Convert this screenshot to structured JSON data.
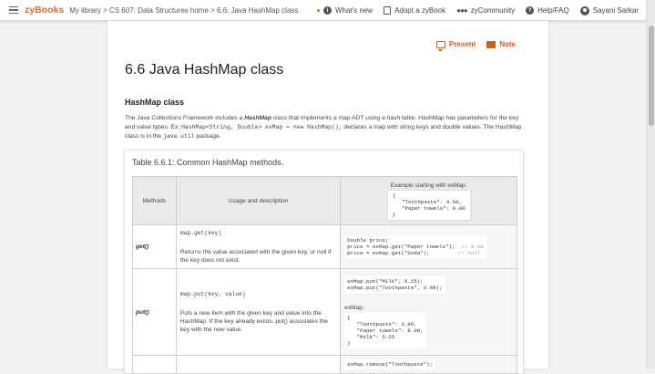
{
  "topbar": {
    "logo": "zyBooks",
    "breadcrumb": "My library > CS 607: Data Structures home > 6.6: Java HashMap class",
    "whats_new": "What's new",
    "adopt": "Adopt a zyBook",
    "community": "zyCommunity",
    "help": "Help/FAQ",
    "user": "Sayani Sarkar"
  },
  "tools": {
    "present": "Present",
    "note": "Note"
  },
  "section": {
    "title": "6.6 Java HashMap class",
    "heading": "HashMap class",
    "para_1": "The Java Collections Framework includes a ",
    "para_bold": "HashMap",
    "para_2": " class that implements a map ADT using a hash table. HashMap has parameters for the key and value types. Ex: ",
    "para_code_1": "HashMap<String, Double> exMap = new HashMap();",
    "para_3": " declares a map with string keys and double values. The HashMap class is in the ",
    "para_code_2": "java.util",
    "para_4": " package."
  },
  "table": {
    "caption": "Table 6.6.1: Common HashMap methods.",
    "headers": {
      "methods": "Methods",
      "usage": "Usage and description",
      "example": "Example starting with exMap:"
    },
    "example_map": "{\n   \"Toothpaste\": 4.50,\n   \"Paper towels\": 8.00\n}",
    "rows": [
      {
        "method": "get()",
        "signature": "map.get(key)",
        "description": "Returns the value associated with the given key, or null if the key does not exist.",
        "code": "Double price;\nprice = exMap.get(\"Paper towels\");",
        "comment_1": "// 8.00",
        "code_2": "price = exMap.get(\"Soda\");",
        "comment_2": "// null"
      },
      {
        "method": "put()",
        "signature": "map.put(key, value)",
        "description": "Puts a new item with the given key and value into the HashMap. If the key already exists, put() associates the key with the new value.",
        "code": "exMap.put(\"Milk\", 5.25);\nexMap.put(\"Toothpaste\", 3.99);",
        "result_label": "exMap:",
        "result": "{\n   \"Toothpaste\": 3.99,\n   \"Paper towels\": 8.00,\n   \"Milk\": 5.25\n}"
      },
      {
        "code": "exMap.remove(\"Toothpaste\");"
      }
    ]
  }
}
